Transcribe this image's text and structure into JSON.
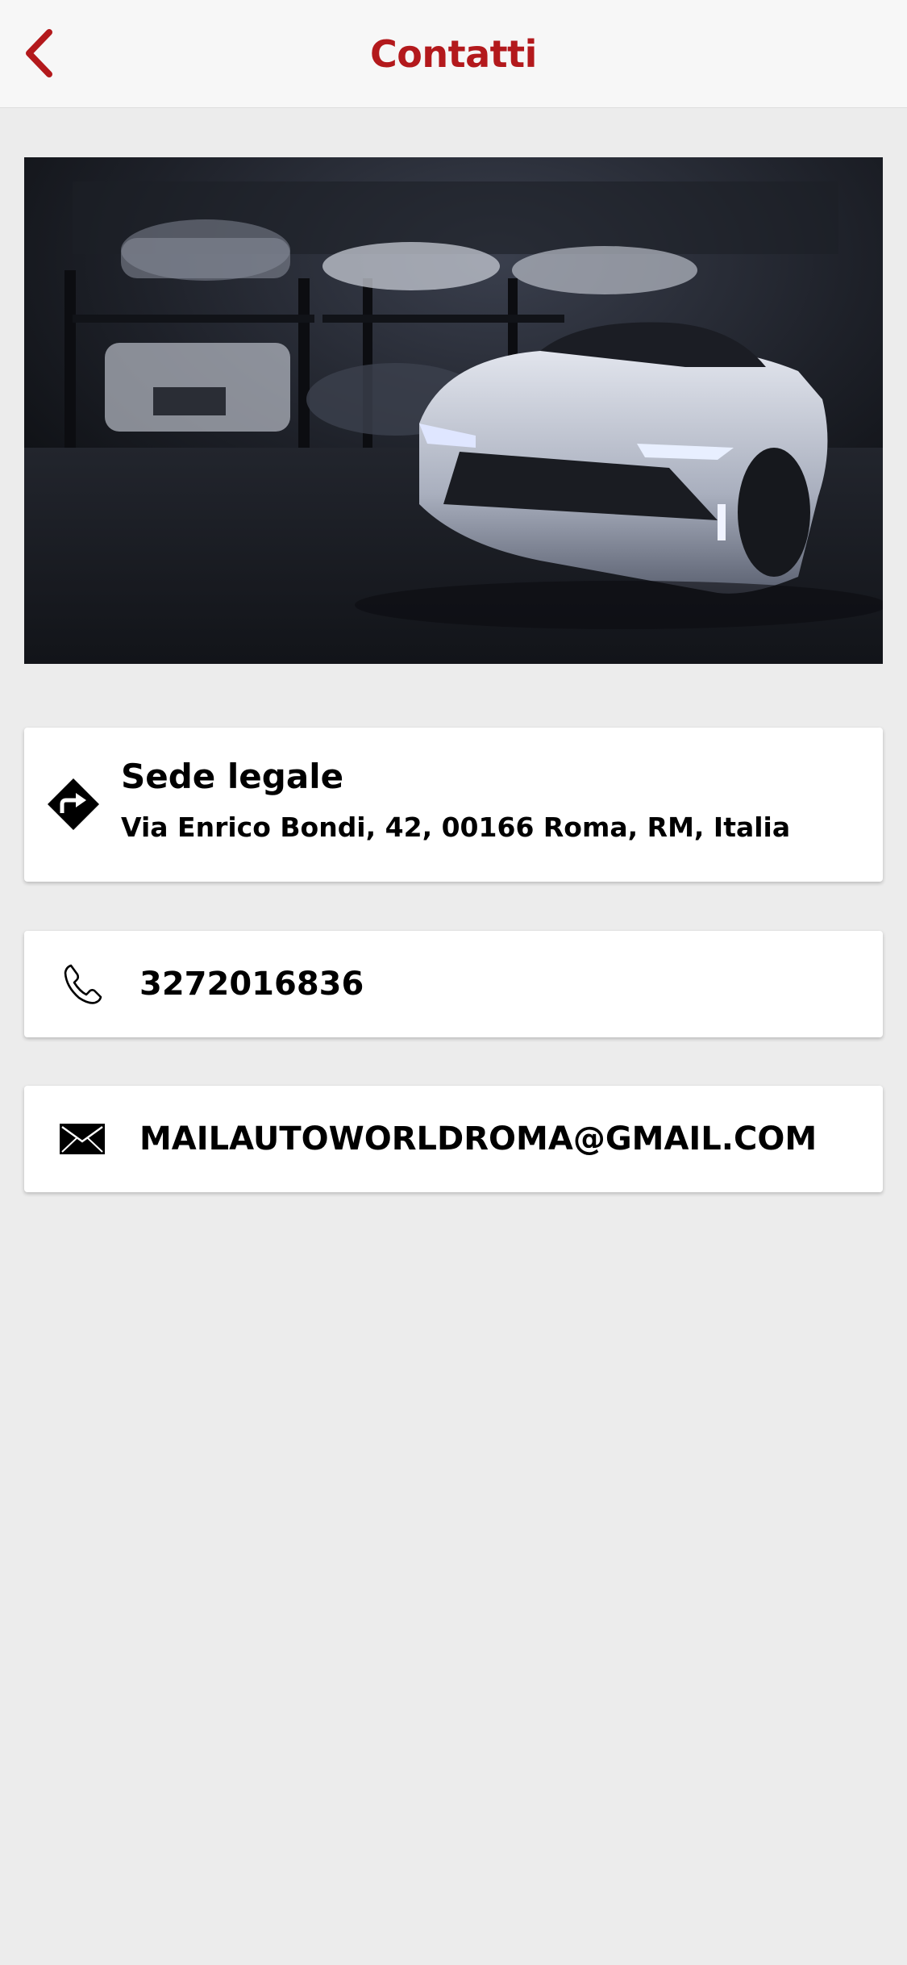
{
  "nav": {
    "title": "Contatti",
    "back_icon": "chevron-left-icon"
  },
  "hero": {
    "image": "luxury-cars-garage-photo"
  },
  "contacts": {
    "address": {
      "icon": "directions-icon",
      "title": "Sede legale",
      "value": "Via Enrico Bondi, 42, 00166 Roma, RM, Italia"
    },
    "phone": {
      "icon": "phone-icon",
      "value": "3272016836"
    },
    "email": {
      "icon": "mail-icon",
      "value": "MAILAUTOWORLDROMA@GMAIL.COM"
    }
  },
  "colors": {
    "accent": "#b3191c",
    "background": "#ececec",
    "card": "#ffffff",
    "nav": "#f7f7f7"
  }
}
